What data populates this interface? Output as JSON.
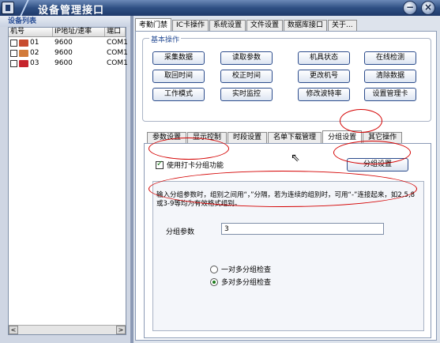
{
  "window": {
    "title": "设备管理接口",
    "min_glyph": "−",
    "close_glyph": "×"
  },
  "device_list": {
    "header": "设备列表",
    "columns": [
      "机号",
      "IP地址/速率",
      "端口"
    ],
    "rows": [
      {
        "id": "01",
        "rate": "9600",
        "port": "COM1",
        "icon_color": "#c84b2e"
      },
      {
        "id": "02",
        "rate": "9600",
        "port": "COM1",
        "icon_color": "#d27a3a"
      },
      {
        "id": "03",
        "rate": "9600",
        "port": "COM1",
        "icon_color": "#c6242c"
      }
    ],
    "scroll_left": "<",
    "scroll_right": ">"
  },
  "top_tabs": [
    "考勤门禁",
    "IC卡操作",
    "系统设置",
    "文件设置",
    "数据库接口",
    "关于..."
  ],
  "top_tab_active": 0,
  "basic_ops": {
    "legend": "基本操作",
    "buttons": [
      "采集数据",
      "读取参数",
      "机具状态",
      "在线检测",
      "取回时间",
      "校正时间",
      "更改机号",
      "清除数据",
      "工作模式",
      "实时监控",
      "修改波特率",
      "设置管理卡"
    ]
  },
  "sub_tabs": [
    "参数设置",
    "显示控制",
    "时段设置",
    "名单下载管理",
    "分组设置",
    "其它操作"
  ],
  "sub_tab_active": 4,
  "group_settings": {
    "enable_label": "使用打卡分组功能",
    "enable_checked": true,
    "setting_button": "分组设置",
    "description": "输入分组参数时，组别之间用“，”分隔，若为连续的组别时，可用“-”连接起来，如2,5,8或3-9等均为有效格式组别。",
    "param_label": "分组参数",
    "param_value": "3",
    "radio_one": "一对多分组检查",
    "radio_many": "多对多分组检查",
    "selected_radio": "many"
  },
  "colors": {
    "annotation_red": "#d40000",
    "title_blue": "#2f4f83",
    "accent_blue": "#2a4f96"
  }
}
